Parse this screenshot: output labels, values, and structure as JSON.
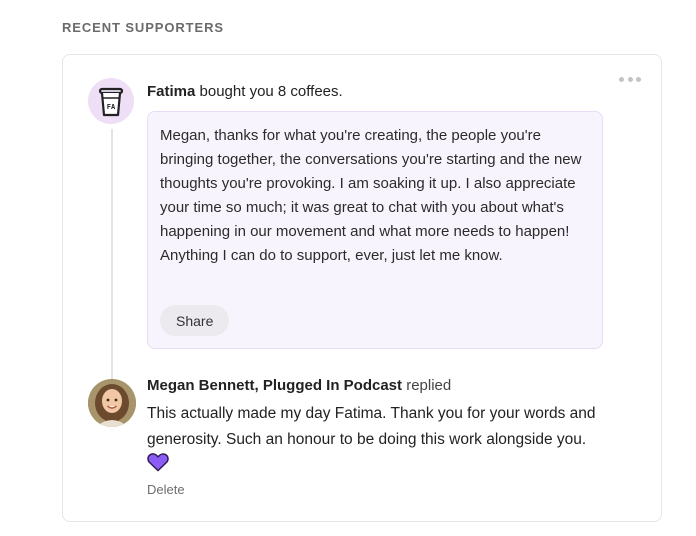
{
  "section": {
    "title": "RECENT SUPPORTERS"
  },
  "supporter": {
    "name": "Fatima",
    "action_text": " bought you 8 coffees.",
    "avatar_initials": "FA",
    "message": "Megan, thanks for what you're creating, the people you're bringing together, the conversations you're starting and the new thoughts you're provoking. I am soaking it up. I also appreciate your time so much; it was great to chat with you about what's happening in our movement and what more needs to happen! Anything I can do to support, ever, just let me know.",
    "share_label": "Share"
  },
  "reply": {
    "author": "Megan Bennett, Plugged In Podcast",
    "action": " replied",
    "text": "This actually made my day Fatima. Thank you for your words and generosity. Such an honour to be doing this work alongside you.",
    "reaction_icon": "purple-heart",
    "delete_label": "Delete"
  },
  "colors": {
    "message_background": "#f8f4fd",
    "message_border": "#e7dcf3",
    "avatar_background": "#eedff7",
    "heart": "#8b5cf6"
  }
}
